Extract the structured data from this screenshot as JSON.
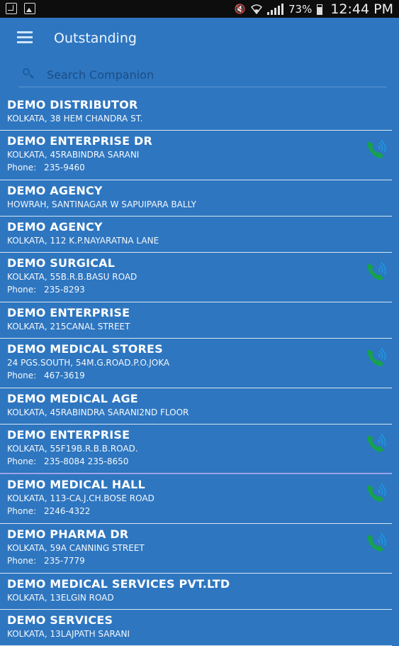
{
  "status": {
    "battery": "73%",
    "time": "12:44 PM"
  },
  "header": {
    "title": "Outstanding"
  },
  "search": {
    "placeholder": "Search Companion"
  },
  "phone_label": "Phone:",
  "accent": {
    "call_icon": "#16a34a",
    "call_wave": "#1b96e0"
  },
  "companions": [
    {
      "name": "DEMO DISTRIBUTOR",
      "address": "KOLKATA, 38 HEM CHANDRA ST.",
      "phone": ""
    },
    {
      "name": "DEMO  ENTERPRISE  DR",
      "address": "KOLKATA, 45RABINDRA SARANI",
      "phone": "235-9460"
    },
    {
      "name": "DEMO  AGENCY",
      "address": "HOWRAH, SANTINAGAR W SAPUIPARA BALLY",
      "phone": ""
    },
    {
      "name": "DEMO  AGENCY",
      "address": "KOLKATA, 112 K.P.NAYARATNA LANE",
      "phone": ""
    },
    {
      "name": "DEMO  SURGICAL",
      "address": "KOLKATA, 55B.R.B.BASU ROAD",
      "phone": "235-8293"
    },
    {
      "name": "DEMO ENTERPRISE",
      "address": "KOLKATA, 215CANAL STREET",
      "phone": ""
    },
    {
      "name": "DEMO  MEDICAL STORES",
      "address": "24 PGS.SOUTH, 54M.G.ROAD.P.O.JOKA",
      "phone": "467-3619"
    },
    {
      "name": " DEMO  MEDICAL AGE",
      "address": "KOLKATA, 45RABINDRA SARANI2ND FLOOR",
      "phone": ""
    },
    {
      "name": "DEMO  ENTERPRISE",
      "address": "KOLKATA, 55F19B.R.B.B.ROAD.",
      "phone": "235-8084 235-8650",
      "highlight": true
    },
    {
      "name": "DEMO  MEDICAL HALL",
      "address": "KOLKATA, 113-CA.J.CH.BOSE ROAD",
      "phone": "2246-4322"
    },
    {
      "name": "DEMO  PHARMA DR",
      "address": "KOLKATA, 59A CANNING STREET",
      "phone": "235-7779"
    },
    {
      "name": "DEMO  MEDICAL SERVICES PVT.LTD",
      "address": "KOLKATA, 13ELGIN ROAD",
      "phone": ""
    },
    {
      "name": "DEMO  SERVICES",
      "address": "KOLKATA, 13LAJPATH SARANI",
      "phone": ""
    }
  ]
}
